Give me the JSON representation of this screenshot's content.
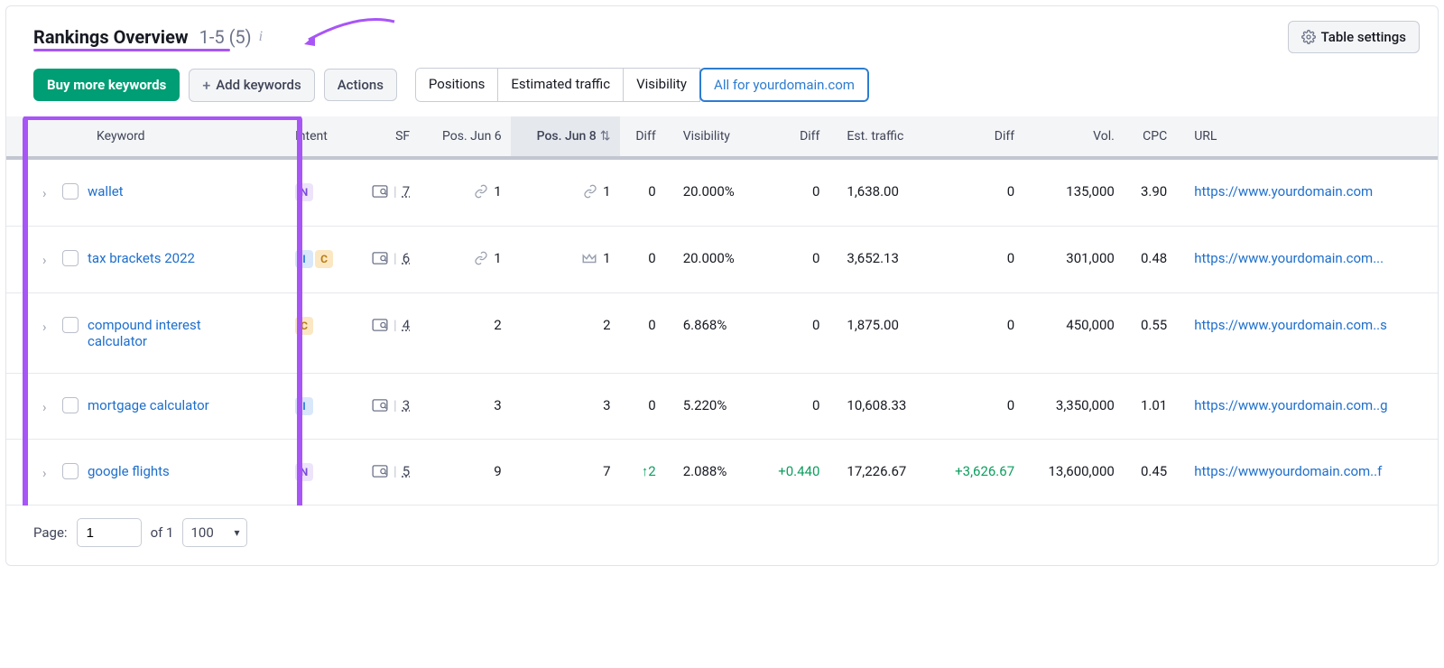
{
  "header": {
    "title": "Rankings Overview",
    "range": "1-5 (5)",
    "table_settings": "Table settings"
  },
  "toolbar": {
    "buy": "Buy more keywords",
    "add": "Add keywords",
    "actions": "Actions",
    "tabs": [
      "Positions",
      "Estimated traffic",
      "Visibility",
      "All for yourdomain.com"
    ],
    "active_tab": 3
  },
  "columns": {
    "keyword": "Keyword",
    "intent": "Intent",
    "sf": "SF",
    "pos1": "Pos. Jun 6",
    "pos2": "Pos. Jun 8",
    "diff1": "Diff",
    "visibility": "Visibility",
    "diff2": "Diff",
    "traffic": "Est. traffic",
    "diff3": "Diff",
    "vol": "Vol.",
    "cpc": "CPC",
    "url": "URL"
  },
  "rows": [
    {
      "keyword": "wallet",
      "intents": [
        "N"
      ],
      "sf": "7",
      "pos1": "1",
      "pos1_icon": "link",
      "pos2": "1",
      "pos2_icon": "link",
      "diff1": "0",
      "visibility": "20.000%",
      "diff2": "0",
      "traffic": "1,638.00",
      "diff3": "0",
      "vol": "135,000",
      "cpc": "3.90",
      "url": "https://www.yourdomain.com"
    },
    {
      "keyword": "tax brackets 2022",
      "intents": [
        "I",
        "C"
      ],
      "sf": "6",
      "pos1": "1",
      "pos1_icon": "link",
      "pos2": "1",
      "pos2_icon": "crown",
      "diff1": "0",
      "visibility": "20.000%",
      "diff2": "0",
      "traffic": "3,652.13",
      "diff3": "0",
      "vol": "301,000",
      "cpc": "0.48",
      "url": "https://www.yourdomain.com..."
    },
    {
      "keyword": "compound interest calculator",
      "intents": [
        "C"
      ],
      "sf": "4",
      "pos1": "2",
      "pos1_icon": "",
      "pos2": "2",
      "pos2_icon": "",
      "diff1": "0",
      "visibility": "6.868%",
      "diff2": "0",
      "traffic": "1,875.00",
      "diff3": "0",
      "vol": "450,000",
      "cpc": "0.55",
      "url": "https://www.yourdomain.com..s"
    },
    {
      "keyword": "mortgage calculator",
      "intents": [
        "I"
      ],
      "sf": "3",
      "pos1": "3",
      "pos1_icon": "",
      "pos2": "3",
      "pos2_icon": "",
      "diff1": "0",
      "visibility": "5.220%",
      "diff2": "0",
      "traffic": "10,608.33",
      "diff3": "0",
      "vol": "3,350,000",
      "cpc": "1.01",
      "url": "https://www.yourdomain.com..g"
    },
    {
      "keyword": "google flights",
      "intents": [
        "N"
      ],
      "sf": "5",
      "pos1": "9",
      "pos1_icon": "",
      "pos2": "7",
      "pos2_icon": "",
      "diff1": "↑2",
      "diff1_green": true,
      "visibility": "2.088%",
      "diff2": "+0.440",
      "diff2_green": true,
      "traffic": "17,226.67",
      "diff3": "+3,626.67",
      "diff3_green": true,
      "vol": "13,600,000",
      "cpc": "0.45",
      "url": "https://wwwyourdomain.com..f"
    }
  ],
  "pager": {
    "page_label": "Page:",
    "page_value": "1",
    "of_label": "of 1",
    "per_page": "100"
  }
}
